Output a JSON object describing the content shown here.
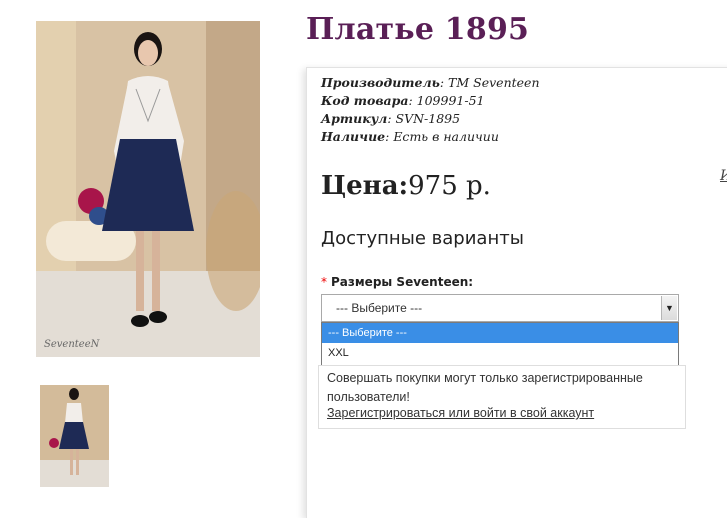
{
  "product": {
    "title": "Платье 1895",
    "info": [
      {
        "label": "Производитель",
        "value": "TM Seventeen"
      },
      {
        "label": "Код товара",
        "value": "109991-51"
      },
      {
        "label": "Артикул",
        "value": "SVN-1895"
      },
      {
        "label": "Наличие",
        "value": "Есть в наличии"
      }
    ],
    "price_label": "Цена:",
    "price_value": "975 р.",
    "side_link": "И"
  },
  "photo": {
    "watermark": "SeventeeN"
  },
  "variants": {
    "heading": "Доступные варианты",
    "required_mark": "*",
    "size_label": "Размеры Seventeen:",
    "selected": "--- Выберите ---",
    "options": [
      "--- Выберите ---",
      "XXL"
    ]
  },
  "notice": {
    "message": "Совершать покупки могут только зарегистрированные пользователи!",
    "link": "Зарегистрироваться или войти в свой аккаунт"
  },
  "colors": {
    "title": "#5a1f56",
    "option_highlight": "#3a8ee6",
    "required": "#ee0000"
  }
}
